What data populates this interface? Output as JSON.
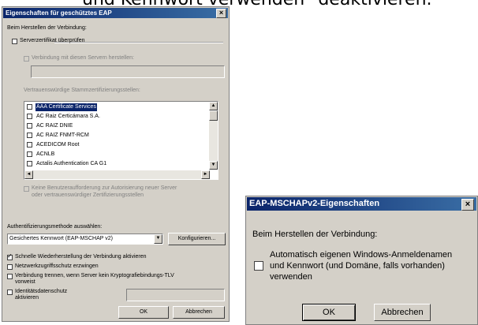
{
  "background_text": "und Kennwort verwenden\" deaktivieren.",
  "dialog1": {
    "title": "Eigenschaften für geschütztes EAP",
    "close_glyph": "×",
    "connect_label": "Beim Herstellen der Verbindung:",
    "verify_cert_label": "Serverzertifikat überprüfen",
    "connect_servers_label": "Verbindung mit diesen Servern herstellen:",
    "trusted_ca_label": "Vertrauenswürdige Stammzertifizierungsstellen:",
    "ca_list": [
      "AAA Certificate Services",
      "AC Raiz Certicámara S.A.",
      "AC RAIZ DNIE",
      "AC RAIZ FNMT-RCM",
      "ACEDICOM Root",
      "ACNLB",
      "Actalis Authentication CA G1"
    ],
    "selected_ca_index": 0,
    "no_prompt_label_line1": "Keine Benutzeraufforderung zur Autorisierung neuer Server",
    "no_prompt_label_line2": "oder vertrauenswürdiger Zertifizierungsstellen",
    "auth_method_label": "Authentifizierungsmethode auswählen:",
    "auth_method_value": "Gesichertes Kennwort (EAP-MSCHAP v2)",
    "configure_button": "Konfigurieren...",
    "fast_reconnect_label": "Schnelle Wiederherstellung der Verbindung aktivieren",
    "fast_reconnect_checked": true,
    "nap_label": "Netzwerkzugriffsschutz erzwingen",
    "disconnect_label_line1": "Verbindung trennen, wenn Server kein Kryptografiebindungs-TLV",
    "disconnect_label_line2": "vorweist",
    "identity_privacy_line1": "Identitätsdatenschutz",
    "identity_privacy_line2": "aktivieren",
    "ok_button": "OK",
    "cancel_button": "Abbrechen"
  },
  "dialog2": {
    "title": "EAP-MSCHAPv2-Eigenschaften",
    "close_glyph": "×",
    "connect_label": "Beim Herstellen der Verbindung:",
    "auto_logon_line1": "Automatisch eigenen Windows-Anmeldenamen",
    "auto_logon_line2": "und Kennwort (und Domäne, falls vorhanden)",
    "auto_logon_line3": "verwenden",
    "auto_logon_checked": false,
    "ok_button": "OK",
    "cancel_button": "Abbrechen"
  },
  "colors": {
    "titlebar_start": "#0a246a",
    "titlebar_end": "#3a6ea5",
    "dialog_face": "#d4d0c8",
    "selection": "#0a246a"
  },
  "icons": {
    "scroll_up": "▲",
    "scroll_down": "▼",
    "scroll_left": "◄",
    "scroll_right": "►",
    "dropdown": "▼"
  }
}
